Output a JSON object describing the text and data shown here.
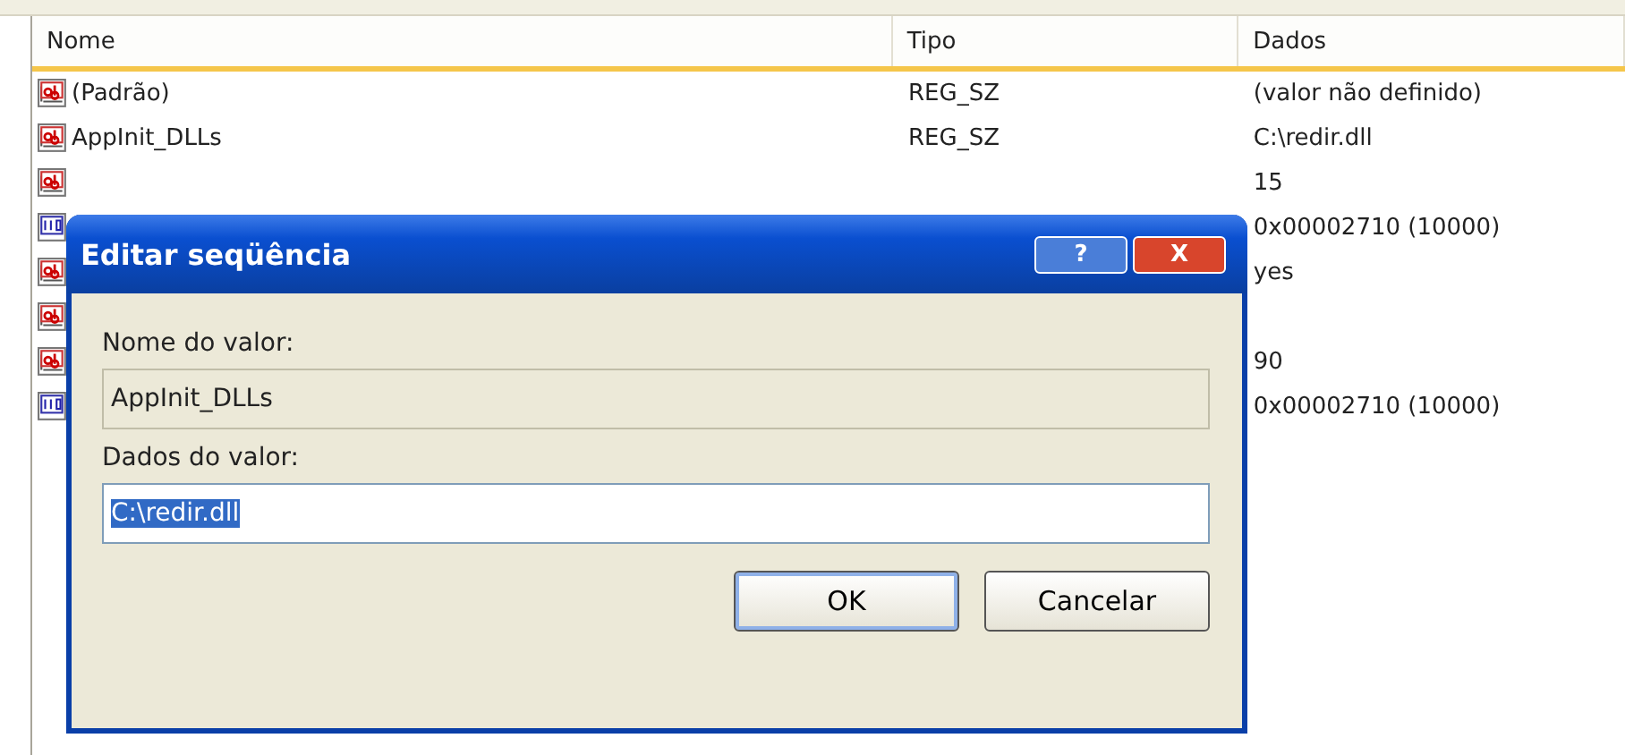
{
  "list": {
    "columns": [
      "Nome",
      "Tipo",
      "Dados"
    ],
    "rows": [
      {
        "kind": "string",
        "name": "(Padrão)",
        "type": "REG_SZ",
        "data": "(valor não definido)"
      },
      {
        "kind": "string",
        "name": "AppInit_DLLs",
        "type": "REG_SZ",
        "data": "C:\\redir.dll"
      },
      {
        "kind": "string",
        "data": "15"
      },
      {
        "kind": "dword",
        "data": "0x00002710 (10000)"
      },
      {
        "kind": "string",
        "data": "yes"
      },
      {
        "kind": "string"
      },
      {
        "kind": "string",
        "data": "90"
      },
      {
        "kind": "dword",
        "data": "0x00002710 (10000)"
      }
    ]
  },
  "dialog": {
    "title": "Editar seqüência",
    "help": "?",
    "close": "X",
    "name_label": "Nome do valor:",
    "name_value": "AppInit_DLLs",
    "data_label": "Dados do valor:",
    "data_value": "C:\\redir.dll",
    "buttons": [
      {
        "label": "OK",
        "default": true
      },
      {
        "label": "Cancelar",
        "default": false
      }
    ]
  }
}
